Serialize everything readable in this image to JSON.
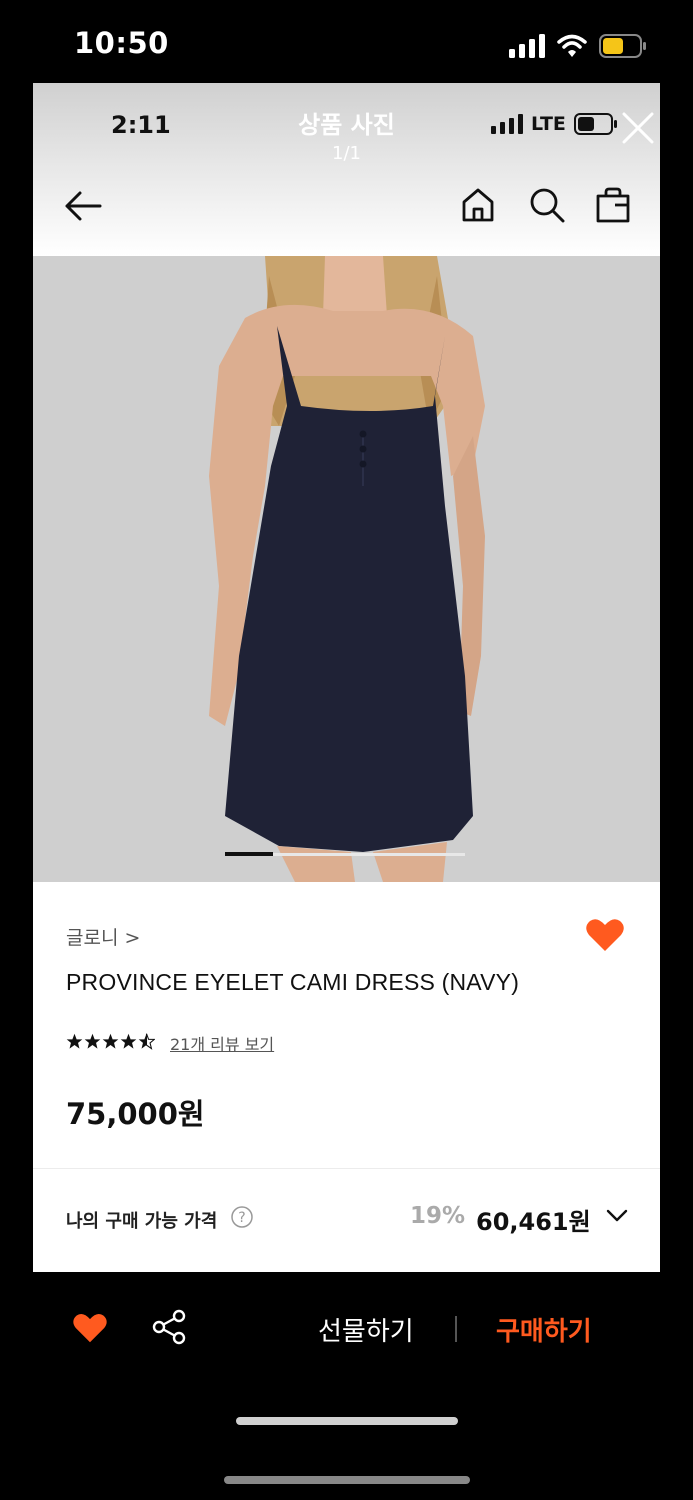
{
  "outer_status": {
    "time": "10:50"
  },
  "inner_status": {
    "time": "2:11",
    "network": "LTE"
  },
  "viewer": {
    "title": "상품 사진",
    "counter": "1/1"
  },
  "nav_icons": [
    "back-arrow-icon",
    "home-icon",
    "search-icon",
    "shopping-bag-icon"
  ],
  "product": {
    "brand": "글로니 >",
    "name": "PROVINCE EYELET CAMI DRESS (NAVY)",
    "rating": 4.5,
    "review_link": "21개 리뷰 보기",
    "price": "75,000원",
    "wishlisted": true
  },
  "my_price": {
    "label": "나의 구매 가능 가격",
    "discount": "19%",
    "value": "60,461원"
  },
  "bottom_bar": {
    "gift_label": "선물하기",
    "buy_label": "구매하기"
  },
  "colors": {
    "accent": "#ff5a1f",
    "dress": "#1f2236",
    "photo_bg": "#cfcfcf"
  }
}
